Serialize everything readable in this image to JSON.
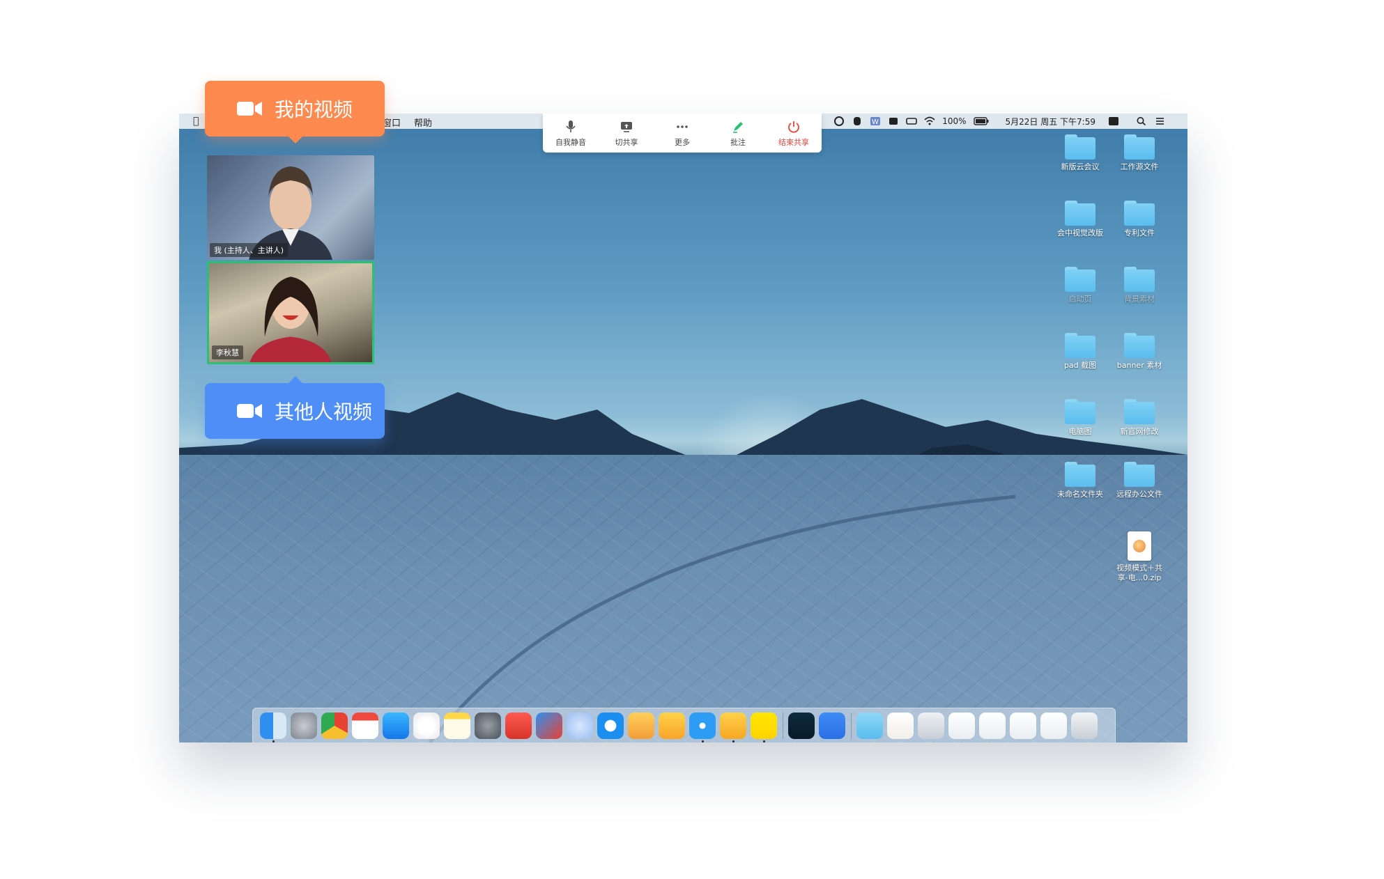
{
  "menubar": {
    "items": [
      "窗口",
      "帮助"
    ],
    "battery": "100%",
    "datetime": "5月22日 周五 下午7:59"
  },
  "share_toolbar": {
    "buttons": [
      {
        "label": "自我静音",
        "icon": "microphone-icon"
      },
      {
        "label": "切共享",
        "icon": "switch-share-icon"
      },
      {
        "label": "更多",
        "icon": "more-icon"
      },
      {
        "label": "批注",
        "icon": "pen-icon"
      },
      {
        "label": "结束共享",
        "icon": "power-icon"
      }
    ]
  },
  "videos": {
    "me_name": "我 (主持人、主讲人)",
    "other_name": "李秋慧"
  },
  "callouts": {
    "my_video": "我的视频",
    "others_video": "其他人视频"
  },
  "desktop": {
    "items": [
      "新版云会议",
      "工作源文件",
      "会中视觉改版",
      "专利文件",
      "启动页",
      "背景素材",
      "pad 截图",
      "banner 素材",
      "电脑图",
      "新官网修改",
      "未命名文件夹",
      "远程办公文件"
    ],
    "zip_label_1": "视频模式＋共",
    "zip_label_2": "享-电...0.zip"
  },
  "colors": {
    "my_video_accent": "#ff8a50",
    "others_video_accent": "#4f8ef6",
    "active_speaker": "#2fbf71",
    "end_share": "#e8453c"
  }
}
